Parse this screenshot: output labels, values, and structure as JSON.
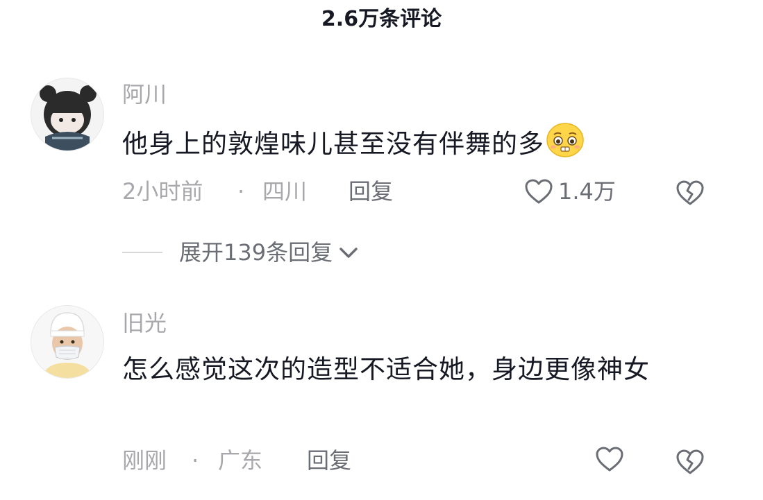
{
  "header": {
    "title": "2.6万条评论"
  },
  "comments": [
    {
      "username": "阿川",
      "text": "他身上的敦煌味儿甚至没有伴舞的多",
      "emoji": "pleading-face-emoji",
      "time": "2小时前",
      "separator": "·",
      "location": "四川",
      "reply_label": "回复",
      "like_count": "1.4万",
      "expand_label": "展开139条回复"
    },
    {
      "username": "旧光",
      "text": "怎么感觉这次的造型不适合她，身边更像神女",
      "time": "刚刚",
      "separator": "·",
      "location": "广东",
      "reply_label": "回复",
      "like_count": ""
    }
  ],
  "icons": {
    "like": "heart-outline-icon",
    "dislike": "broken-heart-icon",
    "expand": "chevron-down-icon"
  },
  "colors": {
    "primary_text": "#161823",
    "secondary_text": "#a8a8ac",
    "action_text": "#6b6d75"
  }
}
